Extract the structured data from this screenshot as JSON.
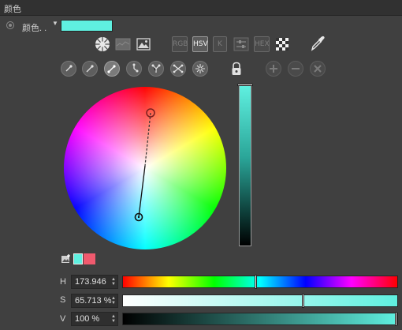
{
  "panel": {
    "title": "颜色"
  },
  "param": {
    "label": "颜色. .",
    "swatch_color": "#5ff0e0"
  },
  "toolbar": {
    "modes": [
      {
        "name": "wheel-mode",
        "icon": "color-wheel-icon"
      },
      {
        "name": "spectrum-mode",
        "icon": "spectrum-icon"
      },
      {
        "name": "image-mode",
        "icon": "image-icon"
      },
      {
        "name": "rgb-mode",
        "label": "RGB",
        "active": false
      },
      {
        "name": "hsv-mode",
        "label": "HSV",
        "active": true
      },
      {
        "name": "k-mode",
        "label": "K",
        "active": false
      },
      {
        "name": "sliders-mode",
        "icon": "sliders-icon"
      },
      {
        "name": "hex-mode",
        "label": "HEX",
        "active": false
      },
      {
        "name": "checker-mode",
        "icon": "checkerboard-icon"
      }
    ],
    "eyedropper_icon": "eyedropper-icon"
  },
  "harmony": {
    "items": [
      "harmony-1-icon",
      "harmony-2-icon",
      "harmony-3-icon",
      "harmony-4-icon",
      "harmony-5-icon",
      "harmony-6-icon",
      "harmony-7-icon"
    ],
    "active_index": 2,
    "lock_icon": "lock-icon",
    "actions": [
      "add-icon",
      "remove-icon",
      "clear-icon"
    ]
  },
  "color": {
    "hue": 173.946,
    "saturation_pct": 65.713,
    "value_pct": 100,
    "current": "#5ff0e0",
    "previous": "#f05a6e"
  },
  "fields": {
    "h": {
      "label": "H",
      "text": "173.946"
    },
    "s": {
      "label": "S",
      "text": "65.713 %"
    },
    "v": {
      "label": "V",
      "text": "100 %"
    }
  }
}
